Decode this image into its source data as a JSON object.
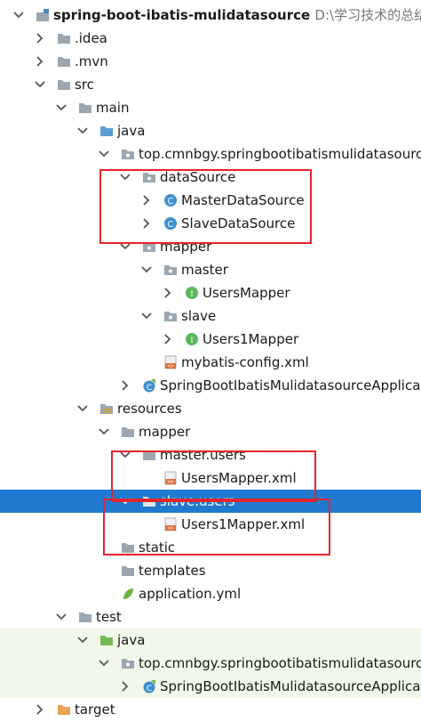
{
  "project": {
    "name": "spring-boot-ibatis-mulidatasource",
    "path": "D:\\学习技术的总结\\Spri"
  },
  "tree": {
    "idea": ".idea",
    "mvn": ".mvn",
    "src": "src",
    "main": "main",
    "java": "java",
    "package": "top.cmnbgy.springbootibatismulidatasource",
    "datasource": "dataSource",
    "master_ds": "MasterDataSource",
    "slave_ds": "SlaveDataSource",
    "mapper": "mapper",
    "master": "master",
    "users_mapper": "UsersMapper",
    "slave": "slave",
    "users1_mapper": "Users1Mapper",
    "mybatis_config": "mybatis-config.xml",
    "app_class": "SpringBootIbatisMulidatasourceApplication",
    "resources": "resources",
    "res_mapper": "mapper",
    "master_users": "master.users",
    "users_mapper_xml": "UsersMapper.xml",
    "slave_users": "slave.users",
    "users1_mapper_xml": "Users1Mapper.xml",
    "static": "static",
    "templates": "templates",
    "application_yml": "application.yml",
    "test": "test",
    "test_java": "java",
    "test_package": "top.cmnbgy.springbootibatismulidatasource",
    "test_app_class": "SpringBootIbatisMulidatasourceApplication",
    "target": "target"
  },
  "colors": {
    "selection": "#1f7ad0",
    "highlight_box": "#e4252b",
    "folder": "#9aa7b0",
    "source_folder": "#5aa0d8",
    "test_folder": "#74b956",
    "class_icon": "#3f8fd0",
    "interface_icon": "#5cb85c",
    "test_background": "#f1f8e9"
  }
}
